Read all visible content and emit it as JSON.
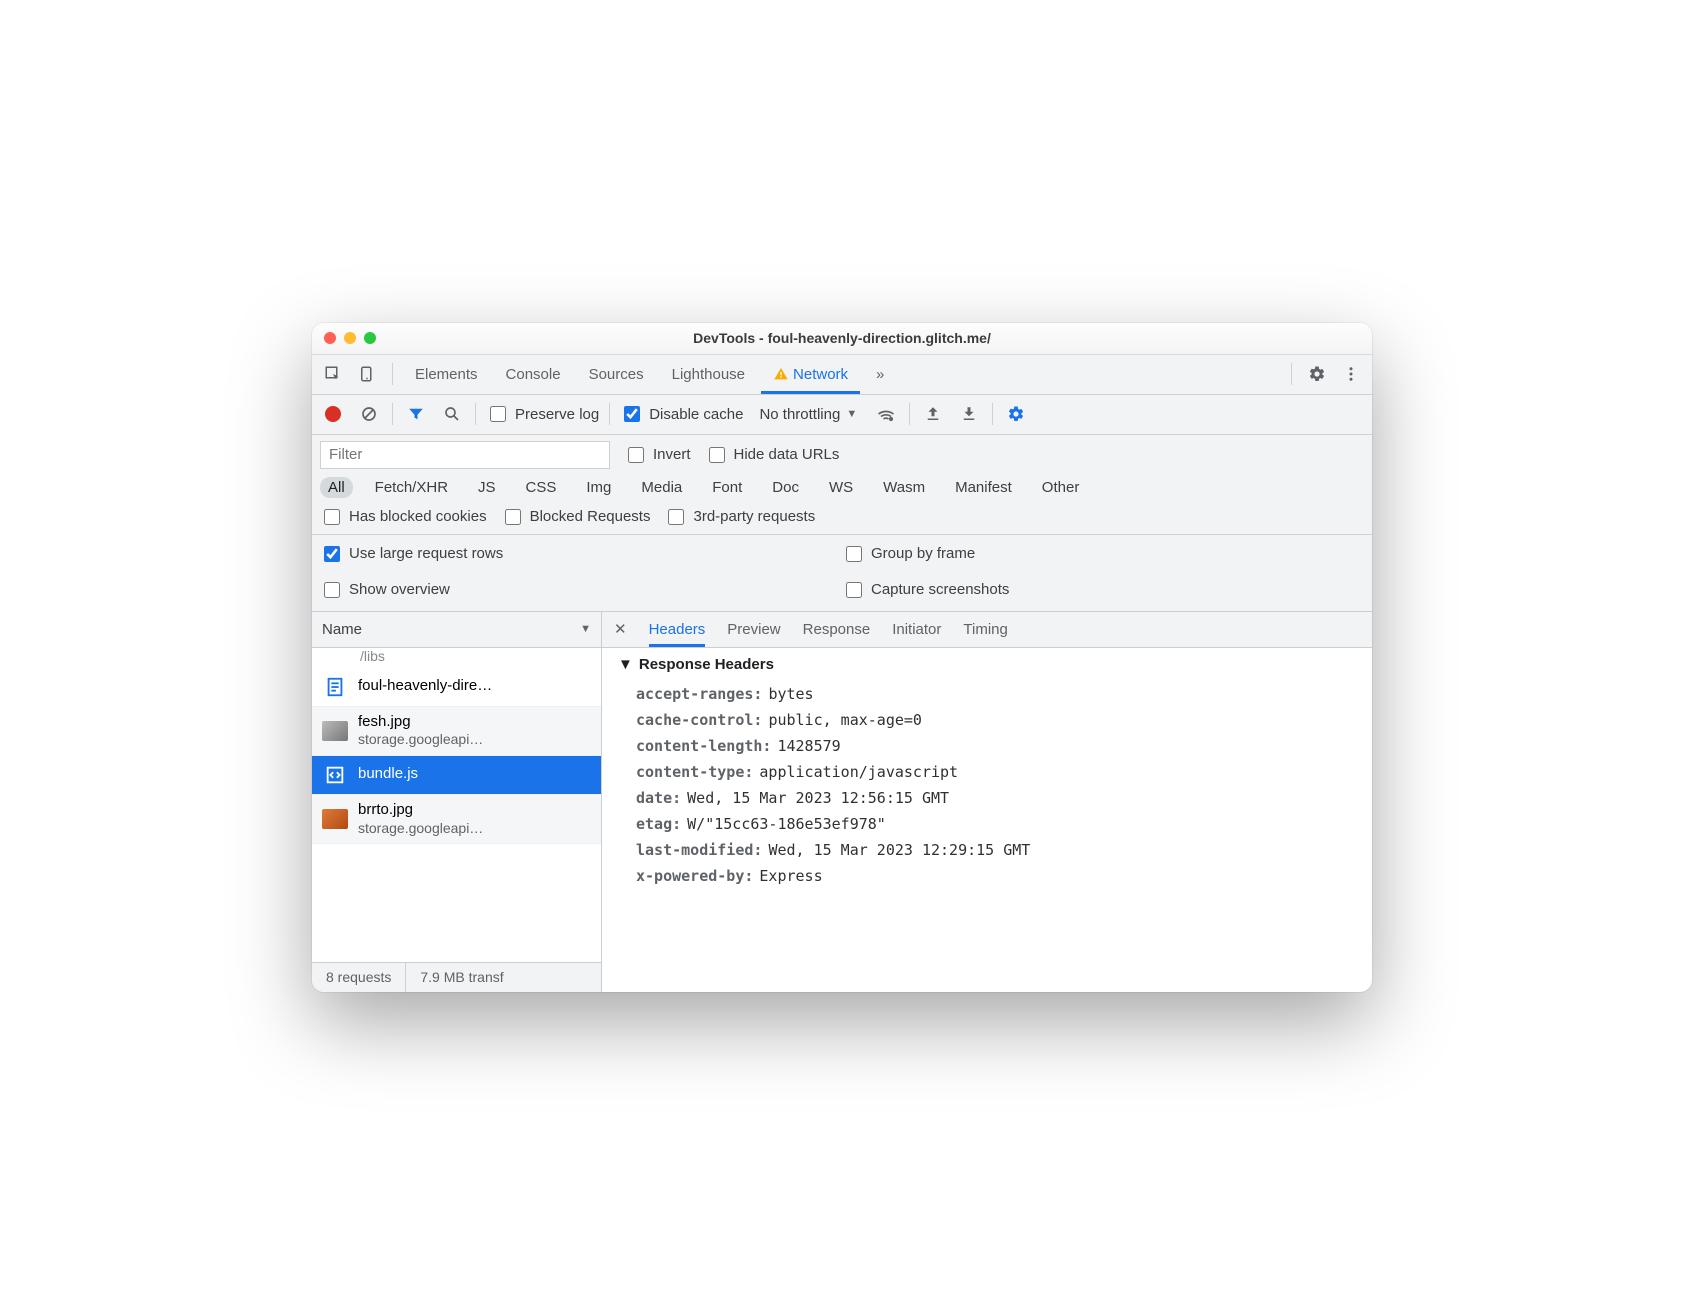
{
  "window": {
    "title": "DevTools - foul-heavenly-direction.glitch.me/"
  },
  "main_tabs": {
    "elements": "Elements",
    "console": "Console",
    "sources": "Sources",
    "lighthouse": "Lighthouse",
    "network": "Network",
    "more": "»"
  },
  "toolbar": {
    "preserve_log": "Preserve log",
    "disable_cache": "Disable cache",
    "throttling": "No throttling"
  },
  "filter": {
    "placeholder": "Filter",
    "invert": "Invert",
    "hide_data_urls": "Hide data URLs",
    "types": [
      "All",
      "Fetch/XHR",
      "JS",
      "CSS",
      "Img",
      "Media",
      "Font",
      "Doc",
      "WS",
      "Wasm",
      "Manifest",
      "Other"
    ],
    "has_blocked_cookies": "Has blocked cookies",
    "blocked_requests": "Blocked Requests",
    "third_party": "3rd-party requests"
  },
  "settings": {
    "large_rows": "Use large request rows",
    "group_by_frame": "Group by frame",
    "show_overview": "Show overview",
    "capture_screenshots": "Capture screenshots"
  },
  "reqlist": {
    "name_col": "Name",
    "partial": "/libs",
    "rows": [
      {
        "name": "foul-heavenly-dire…",
        "sub": ""
      },
      {
        "name": "fesh.jpg",
        "sub": "storage.googleapi…"
      },
      {
        "name": "bundle.js",
        "sub": ""
      },
      {
        "name": "brrto.jpg",
        "sub": "storage.googleapi…"
      }
    ]
  },
  "detail_tabs": {
    "headers": "Headers",
    "preview": "Preview",
    "response": "Response",
    "initiator": "Initiator",
    "timing": "Timing"
  },
  "response_headers": {
    "section": "Response Headers",
    "items": [
      {
        "k": "accept-ranges:",
        "v": "bytes"
      },
      {
        "k": "cache-control:",
        "v": "public, max-age=0"
      },
      {
        "k": "content-length:",
        "v": "1428579"
      },
      {
        "k": "content-type:",
        "v": "application/javascript"
      },
      {
        "k": "date:",
        "v": "Wed, 15 Mar 2023 12:56:15 GMT"
      },
      {
        "k": "etag:",
        "v": "W/\"15cc63-186e53ef978\""
      },
      {
        "k": "last-modified:",
        "v": "Wed, 15 Mar 2023 12:29:15 GMT"
      },
      {
        "k": "x-powered-by:",
        "v": "Express"
      }
    ]
  },
  "status": {
    "requests": "8 requests",
    "transferred": "7.9 MB transf"
  }
}
